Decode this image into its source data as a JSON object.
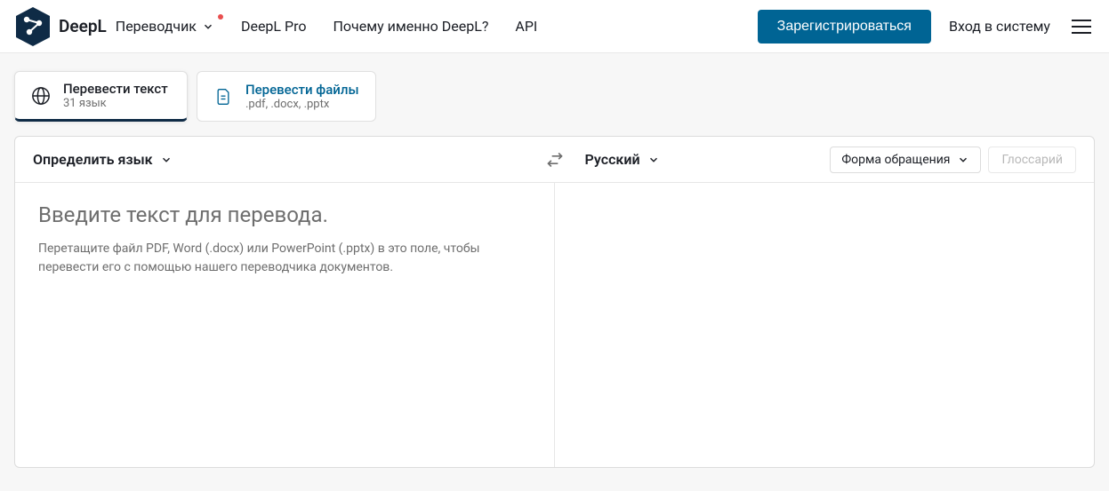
{
  "brand": "DeepL",
  "nav": {
    "translator": "Переводчик",
    "pro": "DeepL Pro",
    "why": "Почему именно DeepL?",
    "api": "API"
  },
  "header": {
    "signup": "Зарегистрироваться",
    "login": "Вход в систему"
  },
  "modeTabs": {
    "text": {
      "title": "Перевести текст",
      "sub": "31 язык"
    },
    "files": {
      "title": "Перевести файлы",
      "sub": ".pdf, .docx, .pptx"
    }
  },
  "langBar": {
    "source": "Определить язык",
    "target": "Русский",
    "formality": "Форма обращения",
    "glossary": "Глоссарий"
  },
  "sourcePane": {
    "placeholder": "Введите текст для перевода.",
    "hint": "Перетащите файл PDF, Word (.docx) или PowerPoint (.pptx) в это поле, чтобы перевести его с помощью нашего переводчика документов."
  }
}
